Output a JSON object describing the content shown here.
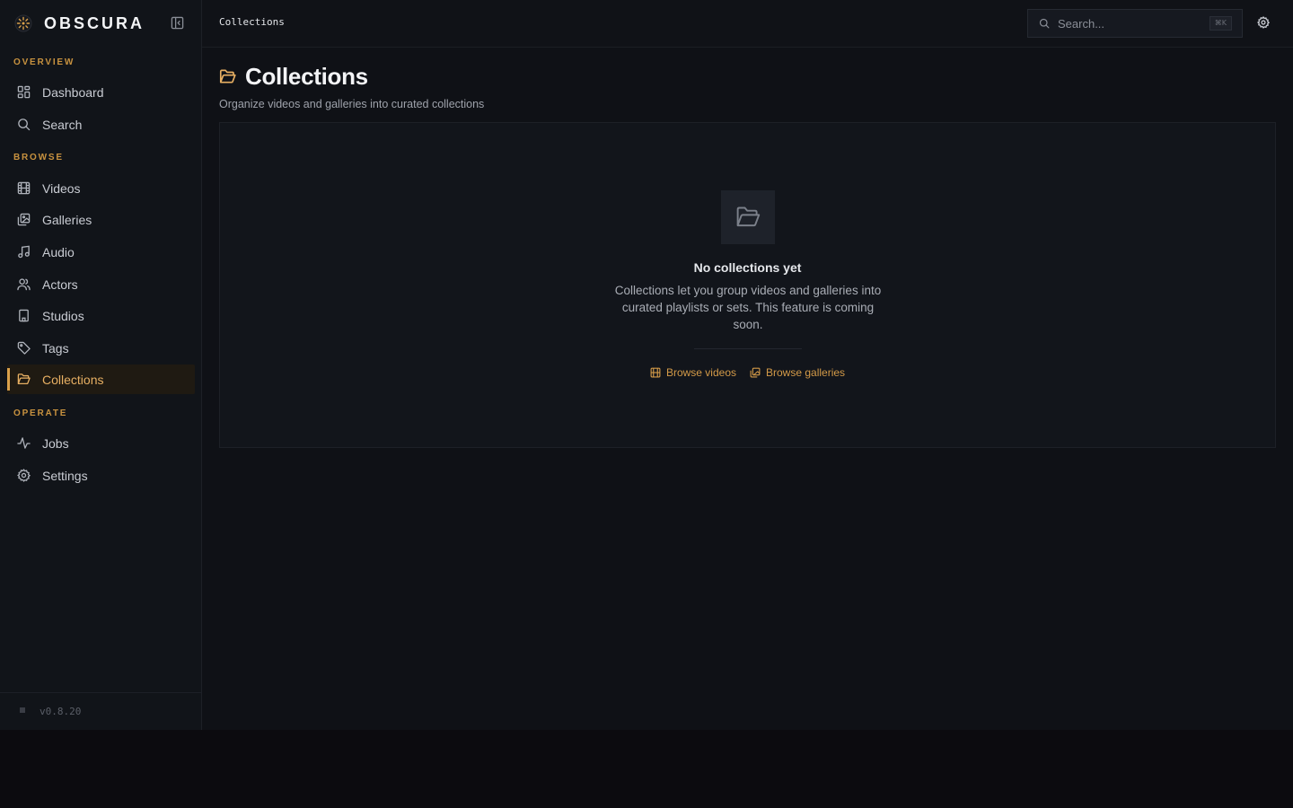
{
  "brand": {
    "name": "OBSCURA"
  },
  "sidebar": {
    "sections": [
      {
        "label": "OVERVIEW",
        "items": [
          {
            "label": "Dashboard",
            "icon": "dashboard-icon"
          },
          {
            "label": "Search",
            "icon": "search-icon"
          }
        ]
      },
      {
        "label": "BROWSE",
        "items": [
          {
            "label": "Videos",
            "icon": "film-icon"
          },
          {
            "label": "Galleries",
            "icon": "images-icon"
          },
          {
            "label": "Audio",
            "icon": "music-icon"
          },
          {
            "label": "Actors",
            "icon": "users-icon"
          },
          {
            "label": "Studios",
            "icon": "building-icon"
          },
          {
            "label": "Tags",
            "icon": "tag-icon"
          },
          {
            "label": "Collections",
            "icon": "folder-open-icon",
            "active": true
          }
        ]
      },
      {
        "label": "OPERATE",
        "items": [
          {
            "label": "Jobs",
            "icon": "activity-icon"
          },
          {
            "label": "Settings",
            "icon": "gear-icon"
          }
        ]
      }
    ],
    "version": "v0.8.20"
  },
  "topbar": {
    "breadcrumb": "Collections",
    "search_placeholder": "Search...",
    "search_shortcut": "⌘K"
  },
  "page": {
    "title": "Collections",
    "subtitle": "Organize videos and galleries into curated collections"
  },
  "empty_state": {
    "title": "No collections yet",
    "description": "Collections let you group videos and galleries into curated playlists or sets. This feature is coming soon.",
    "actions": [
      {
        "label": "Browse videos",
        "icon": "film-icon"
      },
      {
        "label": "Browse galleries",
        "icon": "images-icon"
      }
    ]
  },
  "colors": {
    "accent": "#d9a04a",
    "sidebar_bg": "#111419",
    "main_bg": "#0f1116"
  }
}
